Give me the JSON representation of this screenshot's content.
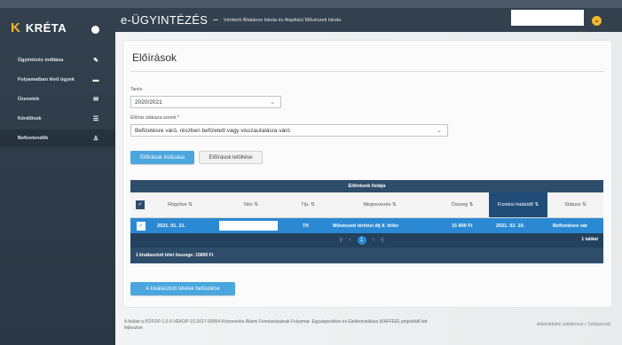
{
  "sidebar": {
    "logo_text": "KRÉTA",
    "items": [
      {
        "label": "Ügyintézés indítása",
        "icon": "edit-icon"
      },
      {
        "label": "Folyamatban lévő ügyek",
        "icon": "folder-icon"
      },
      {
        "label": "Üzenetek",
        "icon": "mail-icon"
      },
      {
        "label": "Kérdőívek",
        "icon": "list-icon"
      },
      {
        "label": "Befizetendők",
        "icon": "person-icon"
      }
    ]
  },
  "header": {
    "app_title": "e-ÜGYINTÉZÉS",
    "dash": "–",
    "school_name": "Vénkerti Általános Iskola és Alapfokú Művészeti Iskola"
  },
  "page": {
    "title": "Előírások",
    "year_label": "Tanév",
    "year_value": "2020/2021",
    "status_label": "Előírás státusza szerint *",
    "status_value": "Befizetésre váró, részben befizetett vagy visszautalásra váró",
    "list_button": "Előírások listázása",
    "download_button": "Előírások letöltése"
  },
  "table": {
    "caption": "Előírások listája",
    "columns": [
      "Rögzítve",
      "Név",
      "Típ.",
      "Megnevezés",
      "Összeg",
      "Fizetési határidő",
      "Státusz"
    ],
    "row": {
      "recorded": "2021. 01. 21.",
      "type": "TK",
      "description": "Művészeti térítési díj II. félév",
      "amount": "15 800 Ft",
      "due_date": "2021. 02. 19.",
      "status": "Befizetésre vár"
    },
    "pager_page": "1",
    "result_count": "1 találat",
    "selected_sum": "1 kiválasztott tétel összege: 15800 Ft",
    "pay_button": "A kiválasztott tételek befizetése"
  },
  "footer": {
    "text": "A felület a KÖFOP-1.0.0-VEKOP-15-2017-00054 Köznevelés Állami Fenntartásának Folyamat- Egységesítése és Elektronizálása (KAFFEE) projektből lett fejlesztve",
    "links": "Adatvédelmi nyilatkozat • Tudásportál"
  }
}
